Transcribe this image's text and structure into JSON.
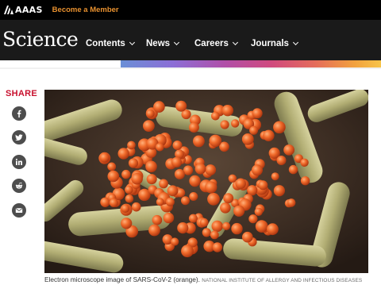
{
  "topbar": {
    "logo_text": "AAAS",
    "member_link": "Become a Member"
  },
  "nav": {
    "brand": "Science",
    "items": [
      {
        "label": "Contents"
      },
      {
        "label": "News"
      },
      {
        "label": "Careers"
      },
      {
        "label": "Journals"
      }
    ]
  },
  "share": {
    "title": "SHARE",
    "buttons": [
      "facebook-icon",
      "twitter-icon",
      "linkedin-icon",
      "reddit-icon",
      "email-icon"
    ]
  },
  "figure": {
    "caption": "Electron microscope image of SARS-CoV-2 (orange).",
    "credit": "NATIONAL INSTITUTE OF ALLERGY AND INFECTIOUS DISEASES"
  },
  "colors": {
    "topbar": "#000000",
    "nav": "#1a1a1a",
    "member_link": "#e8912f",
    "share_title": "#c8102e",
    "share_button": "#4d4d4d",
    "virus": "#e8531f",
    "cell": "#b9b47c"
  }
}
